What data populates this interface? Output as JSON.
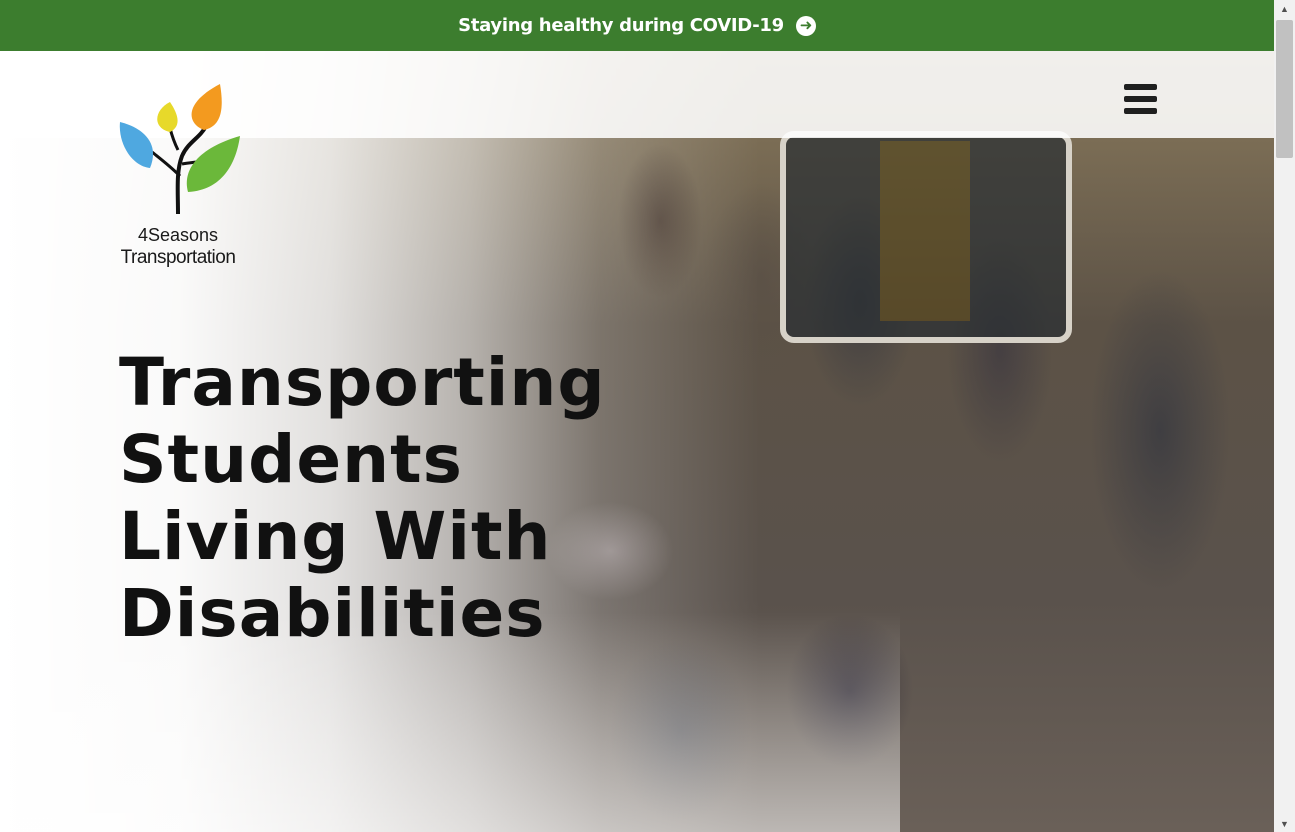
{
  "announcement": {
    "text": "Staying healthy during COVID-19",
    "icon": "arrow-circle-right-icon",
    "background": "#3c7d2e"
  },
  "logo": {
    "line1": "4Seasons",
    "line2": "Transportation",
    "leaf_colors": [
      "#f39a1f",
      "#e7d92a",
      "#4fa8e0",
      "#6bb83a"
    ]
  },
  "menu": {
    "icon": "hamburger-menu-icon"
  },
  "hero": {
    "headline": [
      "Transporting",
      "Students",
      "Living With",
      "Disabilities"
    ],
    "image": "group-photo-of-transportation-staff-in-front-of-school-bus"
  },
  "scrollbar": {
    "up_icon": "scroll-up-arrow-icon",
    "down_icon": "scroll-down-arrow-icon"
  }
}
